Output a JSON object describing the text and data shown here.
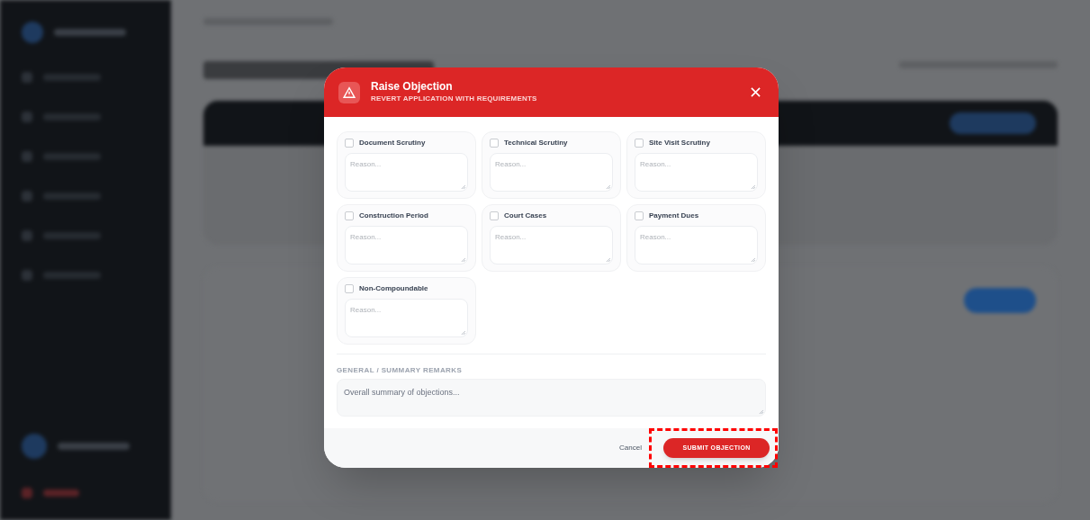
{
  "dialog": {
    "title": "Raise Objection",
    "subtitle": "REVERT APPLICATION WITH REQUIREMENTS",
    "objections": [
      {
        "label": "Document Scrutiny",
        "checked": false,
        "placeholder": "Reason..."
      },
      {
        "label": "Technical Scrutiny",
        "checked": false,
        "placeholder": "Reason..."
      },
      {
        "label": "Site Visit Scrutiny",
        "checked": false,
        "placeholder": "Reason..."
      },
      {
        "label": "Construction Period",
        "checked": false,
        "placeholder": "Reason..."
      },
      {
        "label": "Court Cases",
        "checked": false,
        "placeholder": "Reason..."
      },
      {
        "label": "Payment Dues",
        "checked": false,
        "placeholder": "Reason..."
      },
      {
        "label": "Non-Compoundable",
        "checked": false,
        "placeholder": "Reason..."
      }
    ],
    "remarks": {
      "label": "GENERAL / SUMMARY REMARKS",
      "placeholder": "Overall summary of objections..."
    },
    "cancel": "Cancel",
    "submit": "SUBMIT OBJECTION",
    "submit_highlighted": true
  }
}
